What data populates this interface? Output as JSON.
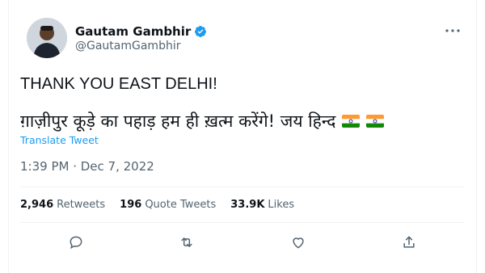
{
  "tweet": {
    "author_name": "Gautam Gambhir",
    "handle": "@GautamGambhir",
    "text_line1": "THANK YOU EAST DELHI!",
    "text_line2": "ग़ाज़ीपुर कूड़े का पहाड़ हम ही ख़त्म करेंगे! जय हिन्द",
    "translate_label": "Translate Tweet",
    "timestamp": "1:39 PM · Dec 7, 2022"
  },
  "stats": {
    "retweets_count": "2,946",
    "retweets_label": "Retweets",
    "quote_count": "196",
    "quote_label": "Quote Tweets",
    "likes_count": "33.9K",
    "likes_label": "Likes"
  },
  "icons": {
    "verified": "verified-badge-icon",
    "more": "more-icon",
    "reply": "reply-icon",
    "retweet": "retweet-icon",
    "like": "like-icon",
    "share": "share-icon"
  },
  "colors": {
    "accent": "#1d9bf0",
    "text": "#0f1419",
    "secondary": "#536471"
  }
}
